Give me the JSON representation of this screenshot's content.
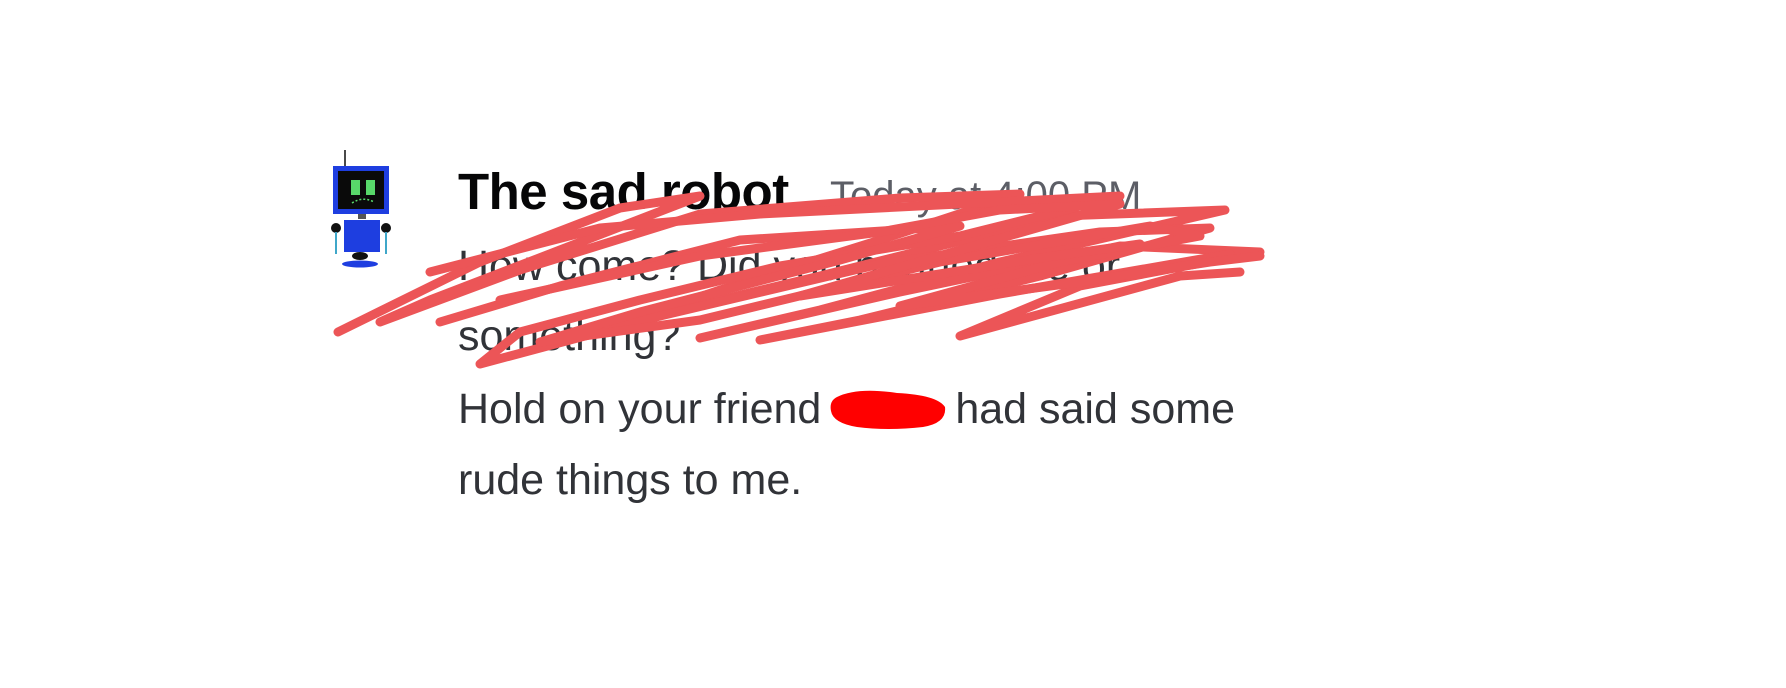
{
  "message": {
    "author": "The sad robot",
    "timestamp": "Today at 4:00 PM",
    "first_paragraph": {
      "line1": "How come? Did you banned me or",
      "line2": "something?",
      "redacted": true
    },
    "second_paragraph": {
      "line1_before": "Hold on your friend",
      "line1_after": "had said some",
      "line2": "rude things to me."
    }
  },
  "avatar": {
    "icon": "sad-robot-avatar-icon",
    "colors": {
      "body": "#1e3ee0",
      "screen": "#0a0a0a",
      "eyes": "#58d86a"
    }
  },
  "colors": {
    "scribble": "#ec5557",
    "redaction": "#ff0000",
    "author": "#060607",
    "text": "#313338",
    "timestamp": "#5c5e66"
  }
}
